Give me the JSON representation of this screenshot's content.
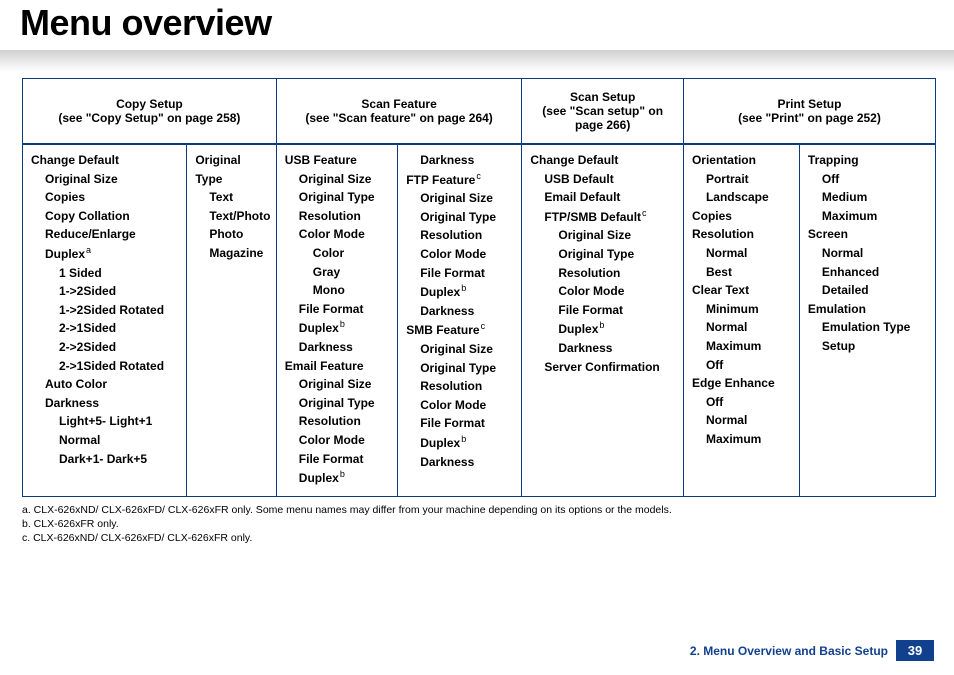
{
  "page_title": "Menu overview",
  "columns": [
    {
      "title": "Copy Setup",
      "sub": "(see \"Copy Setup\" on page 258)"
    },
    {
      "title": "Scan Feature",
      "sub": "(see \"Scan feature\" on page 264)"
    },
    {
      "title": "Scan Setup",
      "sub": "(see \"Scan setup\" on page 266)"
    },
    {
      "title": "Print Setup",
      "sub": "(see \"Print\" on page 252)"
    }
  ],
  "cells": {
    "c00": [
      {
        "t": "Change Default",
        "l": 0
      },
      {
        "t": "Original Size",
        "l": 1
      },
      {
        "t": "Copies",
        "l": 1
      },
      {
        "t": "Copy Collation",
        "l": 1
      },
      {
        "t": "Reduce/Enlarge",
        "l": 1
      },
      {
        "t": "Duplex",
        "sup": "a",
        "l": 1
      },
      {
        "t": "1 Sided",
        "l": 2
      },
      {
        "t": "1->2Sided",
        "l": 2
      },
      {
        "t": "1->2Sided Rotated",
        "l": 2
      },
      {
        "t": "2->1Sided",
        "l": 2
      },
      {
        "t": "2->2Sided",
        "l": 2
      },
      {
        "t": "2->1Sided Rotated",
        "l": 2
      },
      {
        "t": "Auto Color",
        "l": 1
      },
      {
        "t": "Darkness",
        "l": 1
      },
      {
        "t": "Light+5- Light+1",
        "l": 2
      },
      {
        "t": "Normal",
        "l": 2
      },
      {
        "t": "Dark+1- Dark+5",
        "l": 2
      }
    ],
    "c01": [
      {
        "t": "Original Type",
        "l": 0
      },
      {
        "t": "Text",
        "l": 1
      },
      {
        "t": "Text/Photo",
        "l": 1
      },
      {
        "t": "Photo",
        "l": 1
      },
      {
        "t": "Magazine",
        "l": 1
      }
    ],
    "c10": [
      {
        "t": "USB Feature",
        "l": 0
      },
      {
        "t": "Original Size",
        "l": 1
      },
      {
        "t": "Original Type",
        "l": 1
      },
      {
        "t": "Resolution",
        "l": 1
      },
      {
        "t": "Color Mode",
        "l": 1
      },
      {
        "t": "Color",
        "l": 2
      },
      {
        "t": "Gray",
        "l": 2
      },
      {
        "t": "Mono",
        "l": 2
      },
      {
        "t": "File Format",
        "l": 1
      },
      {
        "t": "Duplex",
        "sup": "b",
        "l": 1
      },
      {
        "t": "Darkness",
        "l": 1
      },
      {
        "t": "Email Feature",
        "l": 0
      },
      {
        "t": "Original Size",
        "l": 1
      },
      {
        "t": "Original Type",
        "l": 1
      },
      {
        "t": "Resolution",
        "l": 1
      },
      {
        "t": "Color Mode",
        "l": 1
      },
      {
        "t": "File Format",
        "l": 1
      },
      {
        "t": "Duplex",
        "sup": "b",
        "l": 1
      }
    ],
    "c11": [
      {
        "t": "Darkness",
        "l": 1
      },
      {
        "t": "FTP Feature",
        "sup": "c",
        "l": 0
      },
      {
        "t": "Original Size",
        "l": 1
      },
      {
        "t": "Original Type",
        "l": 1
      },
      {
        "t": "Resolution",
        "l": 1
      },
      {
        "t": "Color Mode",
        "l": 1
      },
      {
        "t": "File Format",
        "l": 1
      },
      {
        "t": "Duplex",
        "sup": "b",
        "l": 1
      },
      {
        "t": "Darkness",
        "l": 1
      },
      {
        "t": "SMB Feature",
        "sup": "c",
        "l": 0
      },
      {
        "t": "Original Size",
        "l": 1
      },
      {
        "t": "Original Type",
        "l": 1
      },
      {
        "t": "Resolution",
        "l": 1
      },
      {
        "t": "Color Mode",
        "l": 1
      },
      {
        "t": "File Format",
        "l": 1
      },
      {
        "t": "Duplex",
        "sup": "b",
        "l": 1
      },
      {
        "t": "Darkness",
        "l": 1
      }
    ],
    "c20": [
      {
        "t": "Change Default",
        "l": 0
      },
      {
        "t": "USB Default",
        "l": 1
      },
      {
        "t": "Email Default",
        "l": 1
      },
      {
        "t": "FTP/SMB Default",
        "sup": "c",
        "l": 1
      },
      {
        "t": "Original Size",
        "l": 2
      },
      {
        "t": "Original Type",
        "l": 2
      },
      {
        "t": "Resolution",
        "l": 2
      },
      {
        "t": "Color Mode",
        "l": 2
      },
      {
        "t": "File Format",
        "l": 2
      },
      {
        "t": "Duplex",
        "sup": "b",
        "l": 2
      },
      {
        "t": "Darkness",
        "l": 2
      },
      {
        "t": "Server Confirmation",
        "l": 1
      }
    ],
    "c30": [
      {
        "t": "Orientation",
        "l": 0
      },
      {
        "t": "Portrait",
        "l": 1
      },
      {
        "t": "Landscape",
        "l": 1
      },
      {
        "t": "Copies",
        "l": 0
      },
      {
        "t": "Resolution",
        "l": 0
      },
      {
        "t": "Normal",
        "l": 1
      },
      {
        "t": "Best",
        "l": 1
      },
      {
        "t": "Clear Text",
        "l": 0
      },
      {
        "t": "Minimum",
        "l": 1
      },
      {
        "t": "Normal",
        "l": 1
      },
      {
        "t": "Maximum",
        "l": 1
      },
      {
        "t": "Off",
        "l": 1
      },
      {
        "t": "Edge Enhance",
        "l": 0
      },
      {
        "t": "Off",
        "l": 1
      },
      {
        "t": "Normal",
        "l": 1
      },
      {
        "t": "Maximum",
        "l": 1
      }
    ],
    "c31": [
      {
        "t": "Trapping",
        "l": 0
      },
      {
        "t": "Off",
        "l": 1
      },
      {
        "t": "Medium",
        "l": 1
      },
      {
        "t": "Maximum",
        "l": 1
      },
      {
        "t": "Screen",
        "l": 0
      },
      {
        "t": "Normal",
        "l": 1
      },
      {
        "t": "Enhanced",
        "l": 1
      },
      {
        "t": "Detailed",
        "l": 1
      },
      {
        "t": "Emulation",
        "l": 0
      },
      {
        "t": "Emulation Type",
        "l": 1
      },
      {
        "t": "Setup",
        "l": 1
      }
    ]
  },
  "footnotes": [
    {
      "k": "a.",
      "t": "CLX-626xND/ CLX-626xFD/ CLX-626xFR only. Some menu names may differ from your machine depending on its options or the models."
    },
    {
      "k": "b.",
      "t": "CLX-626xFR only."
    },
    {
      "k": "c.",
      "t": "CLX-626xND/ CLX-626xFD/ CLX-626xFR only."
    }
  ],
  "footer": {
    "chapter": "2. Menu Overview and Basic Setup",
    "page": "39"
  }
}
